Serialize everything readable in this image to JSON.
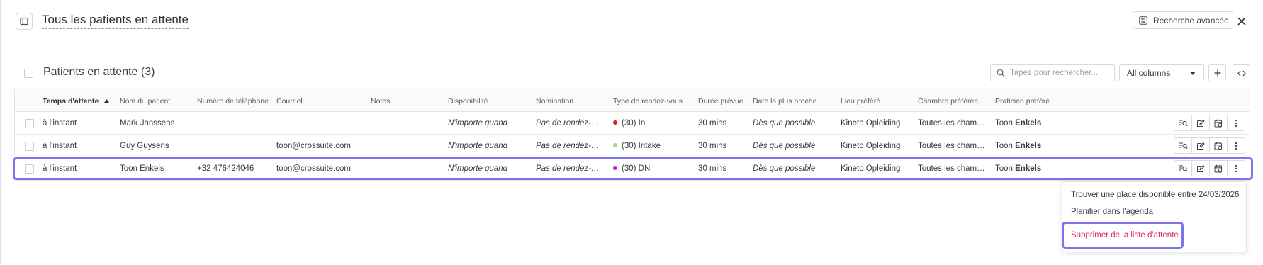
{
  "header": {
    "title": "Tous les patients en attente",
    "advanced_search_label": "Recherche avancée"
  },
  "section": {
    "title": "Patients en attente (3)"
  },
  "search": {
    "placeholder": "Tapez pour rechercher..."
  },
  "column_filter": {
    "selected": "All columns"
  },
  "table": {
    "headers": {
      "wait_time": "Temps d'attente",
      "patient_name": "Nom du patient",
      "phone": "Numéro de téléphone",
      "email": "Courriel",
      "notes": "Notes",
      "availability": "Disponibilité",
      "nomination": "Nomination",
      "appointment_type": "Type de rendez-vous",
      "duration": "Durée prévue",
      "nearest_date": "Date la plus proche",
      "location": "Lieu préféré",
      "room": "Chambre préférée",
      "practitioner": "Praticien préféré"
    },
    "sort_column": "wait_time",
    "sort_direction": "ascending",
    "rows": [
      {
        "wait_time": "à l'instant",
        "patient_name": "Mark Janssens",
        "phone": "",
        "email": "",
        "notes": "",
        "availability": "N'importe quand",
        "nomination": "Pas de rendez-vous",
        "appointment_type": "(30) In",
        "type_color": "#e8192c",
        "duration": "30 mins",
        "nearest_date": "Dès que possible",
        "location": "Kineto Opleiding",
        "room": "Toutes les chambres",
        "practitioner_first": "Toon",
        "practitioner_last": "Enkels",
        "selected": false
      },
      {
        "wait_time": "à l'instant",
        "patient_name": "Guy Guysens",
        "phone": "",
        "email": "toon@crossuite.com",
        "notes": "",
        "availability": "N'importe quand",
        "nomination": "Pas de rendez-vous",
        "appointment_type": "(30) Intake",
        "type_color": "#a8d48c",
        "duration": "30 mins",
        "nearest_date": "Dès que possible",
        "location": "Kineto Opleiding",
        "room": "Toutes les chambres",
        "practitioner_first": "Toon",
        "practitioner_last": "Enkels",
        "selected": false
      },
      {
        "wait_time": "à l'instant",
        "patient_name": "Toon Enkels",
        "phone": "+32 476424046",
        "email": "toon@crossuite.com",
        "notes": "",
        "availability": "N'importe quand",
        "nomination": "Pas de rendez-vous",
        "appointment_type": "(30) DN",
        "type_color": "#d21fd2",
        "duration": "30 mins",
        "nearest_date": "Dès que possible",
        "location": "Kineto Opleiding",
        "room": "Toutes les chambres",
        "practitioner_first": "Toon",
        "practitioner_last": "Enkels",
        "selected": true
      }
    ]
  },
  "context_menu": {
    "items": [
      "Trouver une place disponible entre 24/03/2026",
      "Planifier dans l'agenda"
    ],
    "danger_item": "Supprimer de la liste d'attente"
  },
  "colors": {
    "highlight": "#7a75e8",
    "danger": "#e0245e",
    "background": "#ffffff"
  }
}
